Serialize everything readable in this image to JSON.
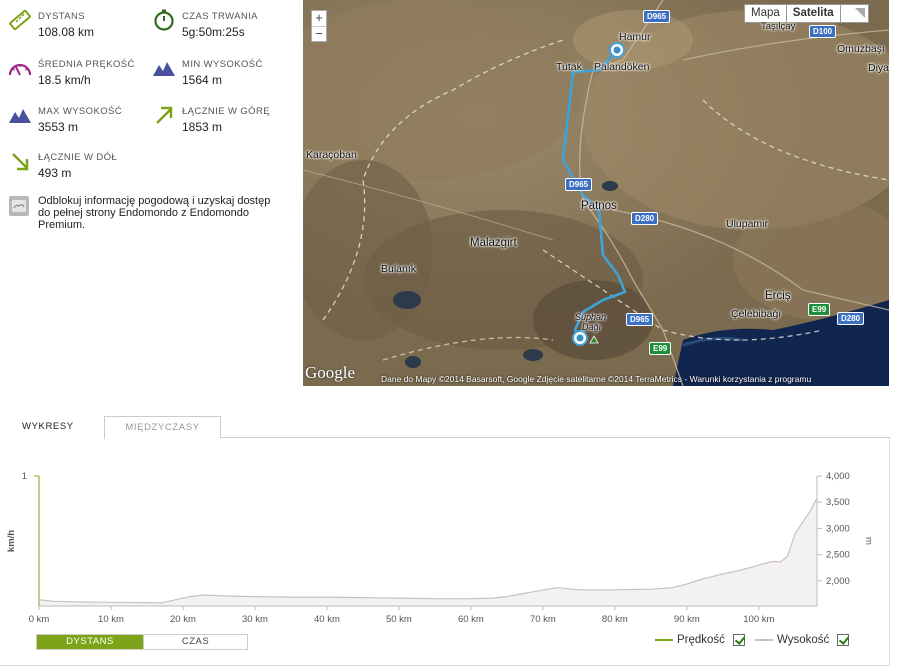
{
  "stats": {
    "distance": {
      "label": "DYSTANS",
      "value": "108.08 km"
    },
    "duration": {
      "label": "CZAS TRWANIA",
      "value": "5g:50m:25s"
    },
    "avg_speed": {
      "label": "ŚREDNIA PRĘKOŚĆ",
      "value": "18.5 km/h"
    },
    "min_alt": {
      "label": "MIN WYSOKOŚĆ",
      "value": "1564 m"
    },
    "max_alt": {
      "label": "MAX WYSOKOŚĆ",
      "value": "3553 m"
    },
    "ascent": {
      "label": "ŁĄCZNIE W GÓRĘ",
      "value": "1853 m"
    },
    "descent": {
      "label": "ŁĄCZNIE W DÓŁ",
      "value": "493 m"
    }
  },
  "promo": {
    "text": "Odblokuj informację pogodową i uzyskaj dostęp do pełnej strony Endomondo z Endomondo Premium."
  },
  "map": {
    "zoom_in": "+",
    "zoom_out": "−",
    "type_map": "Mapa",
    "type_sat": "Satelita",
    "logo": "Google",
    "attribution": "Dane do Mapy ©2014 Basarsoft, Google Zdjęcie satelitarne ©2014 TerraMetrics - Warunki korzystania z programu",
    "places": {
      "hamur": "Hamur",
      "tasilcay": "Taşılçay",
      "omuzbasi": "Omuzbaşı",
      "diya": "Diya",
      "tutak": "Tutak",
      "palandoken": "Palandöken",
      "karacoban": "Karaçoban",
      "patnos": "Patnos",
      "ulupamir": "Ulupamir",
      "malazgirt": "Malazgirt",
      "bulanik": "Bulanık",
      "suphan": "Süphan",
      "dagi": "Dağı",
      "ercis": "Erciş",
      "celebibagi": "Çelebibağı"
    },
    "roads": {
      "d965a": "D965",
      "d100": "D100",
      "d965b": "D965",
      "d280a": "D280",
      "d965c": "D965",
      "e99a": "E99",
      "e99b": "E99",
      "d280b": "D280"
    }
  },
  "tabs": {
    "charts": "WYKRESY",
    "splits": "MIĘDZYCZASY"
  },
  "chart_data": {
    "type": "area",
    "x_label": "km",
    "y_left_label": "km/h",
    "y_right_label": "m",
    "y_left_ticks": [
      "1"
    ],
    "y_right_ticks": [
      "2,000",
      "2,500",
      "3,000",
      "3,500",
      "4,000"
    ],
    "x_ticks": [
      "0 km",
      "10 km",
      "20 km",
      "30 km",
      "40 km",
      "50 km",
      "60 km",
      "70 km",
      "80 km",
      "90 km",
      "100 km"
    ],
    "xlim": [
      0,
      108.08
    ],
    "ylim_right": [
      1520,
      4000
    ],
    "series": [
      {
        "name": "Wysokość",
        "color": "#c8c0c8",
        "x": [
          0,
          2,
          5,
          10,
          15,
          17,
          19,
          21,
          23,
          26,
          30,
          35,
          40,
          45,
          50,
          55,
          60,
          63,
          65,
          67,
          69,
          71,
          72,
          75,
          80,
          85,
          88,
          90,
          92,
          95,
          97,
          99,
          101,
          102,
          103,
          104,
          105,
          106,
          107,
          108
        ],
        "values": [
          1640,
          1610,
          1600,
          1590,
          1585,
          1580,
          1640,
          1700,
          1730,
          1710,
          1700,
          1690,
          1690,
          1680,
          1670,
          1660,
          1660,
          1670,
          1700,
          1750,
          1800,
          1850,
          1870,
          1830,
          1830,
          1840,
          1870,
          1940,
          2030,
          2130,
          2190,
          2260,
          2340,
          2370,
          2360,
          2470,
          2890,
          3100,
          3300,
          3553
        ]
      },
      {
        "name": "Prędkość",
        "color": "#7da418",
        "x": [],
        "values": []
      }
    ]
  },
  "chart_controls": {
    "distance": "DYSTANS",
    "time": "CZAS"
  },
  "legend": {
    "speed": "Prędkość",
    "altitude": "Wysokość"
  },
  "colors": {
    "accent_green": "#7da418",
    "route_blue": "#3fa3d9",
    "altitude_fill": "#f4f1f4"
  }
}
